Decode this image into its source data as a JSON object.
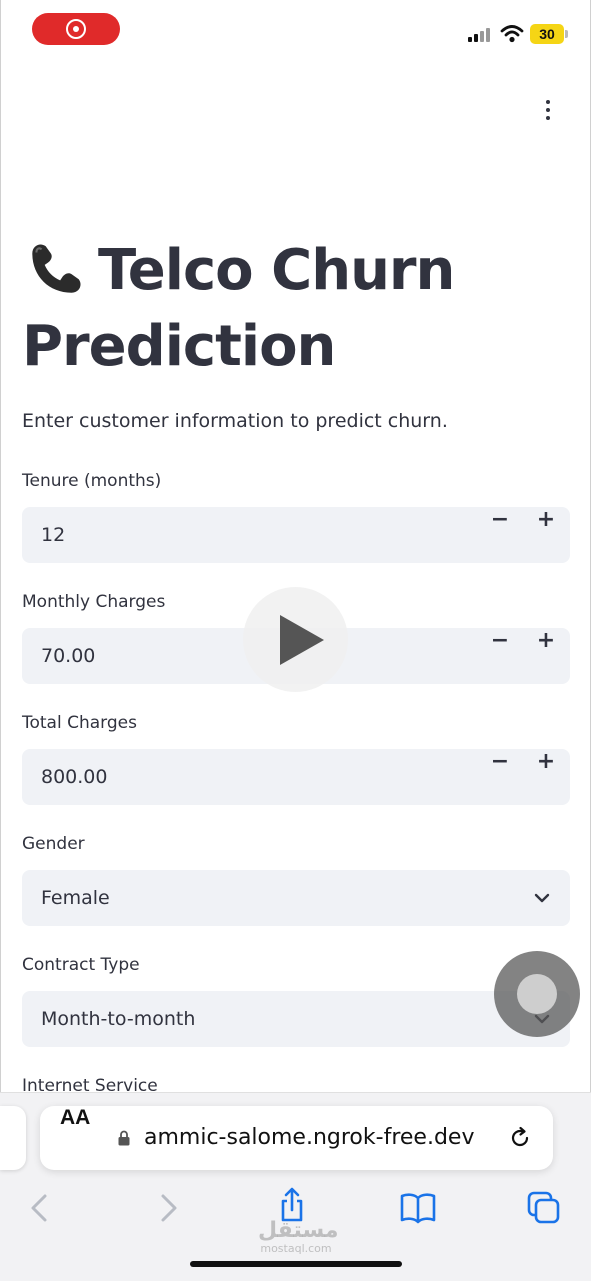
{
  "status_bar": {
    "battery_level": "30",
    "recording": true
  },
  "app": {
    "title_line1": "Telco Churn",
    "title_line2": "Prediction",
    "subtitle": "Enter customer information to predict churn."
  },
  "fields": {
    "tenure": {
      "label": "Tenure (months)",
      "value": "12",
      "minus": "−",
      "plus": "+"
    },
    "monthly_charges": {
      "label": "Monthly Charges",
      "value": "70.00",
      "minus": "−",
      "plus": "+"
    },
    "total_charges": {
      "label": "Total Charges",
      "value": "800.00",
      "minus": "−",
      "plus": "+"
    },
    "gender": {
      "label": "Gender",
      "selected": "Female"
    },
    "contract_type": {
      "label": "Contract Type",
      "selected": "Month-to-month"
    },
    "internet_service": {
      "label": "Internet Service"
    }
  },
  "browser": {
    "aa_label": "AA",
    "url": "ammic-salome.ngrok-free.dev",
    "icons": [
      "back-icon",
      "forward-icon",
      "share-icon",
      "bookmarks-icon",
      "tabs-icon",
      "lock-icon",
      "reload-icon"
    ]
  },
  "watermark": {
    "arabic": "مستقل",
    "latin": "mostaql.com"
  },
  "colors": {
    "accent_blue": "#1a73e8",
    "field_bg": "#f0f2f6",
    "text": "#31333f",
    "record_red": "#e02a2a",
    "battery_yellow": "#f5d515"
  }
}
